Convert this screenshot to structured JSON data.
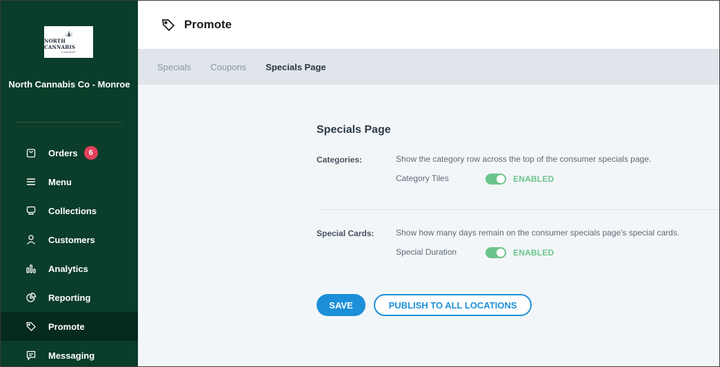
{
  "sidebar": {
    "logo": {
      "brand": "NORTH CANNABIS",
      "sub": "COMPANY"
    },
    "store_name": "North Cannabis Co - Monroe",
    "items": [
      {
        "label": "Orders",
        "icon": "bag-icon",
        "badge": "6"
      },
      {
        "label": "Menu",
        "icon": "menu-icon"
      },
      {
        "label": "Collections",
        "icon": "collections-icon"
      },
      {
        "label": "Customers",
        "icon": "user-icon"
      },
      {
        "label": "Analytics",
        "icon": "bar-chart-icon"
      },
      {
        "label": "Reporting",
        "icon": "pie-chart-icon"
      },
      {
        "label": "Promote",
        "icon": "tag-icon",
        "active": true
      },
      {
        "label": "Messaging",
        "icon": "message-icon"
      }
    ]
  },
  "header": {
    "title": "Promote",
    "icon": "tag-icon"
  },
  "tabs": [
    {
      "label": "Specials"
    },
    {
      "label": "Coupons"
    },
    {
      "label": "Specials Page",
      "active": true
    }
  ],
  "main": {
    "title": "Specials Page",
    "rows": [
      {
        "label": "Categories:",
        "description": "Show the category row across the top of the consumer specials page.",
        "toggle_label": "Category Tiles",
        "toggle_on": true,
        "status": "ENABLED"
      },
      {
        "label": "Special Cards:",
        "description": "Show how many days remain on the consumer specials page's special cards.",
        "toggle_label": "Special Duration",
        "toggle_on": true,
        "status": "ENABLED"
      }
    ],
    "save_label": "SAVE",
    "publish_label": "PUBLISH TO ALL LOCATIONS"
  },
  "colors": {
    "sidebar_bg": "#0a3d2a",
    "accent": "#1c8fd9",
    "toggle_on": "#6cc48b",
    "badge": "#e0405a"
  }
}
